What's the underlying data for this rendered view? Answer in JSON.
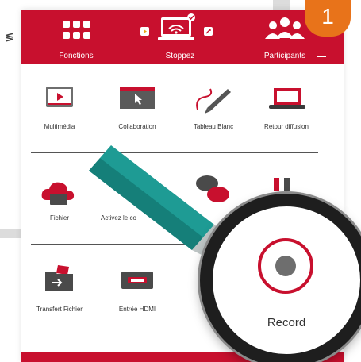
{
  "step_number": "1",
  "toolbar": {
    "fonctions_label": "Fonctions",
    "stop_label": "Stoppez",
    "participants_label": "Participants"
  },
  "row1": [
    {
      "label": "Multimédia",
      "icon": "multimedia-icon"
    },
    {
      "label": "Collaboration",
      "icon": "collaboration-icon"
    },
    {
      "label": "Tableau Blanc",
      "icon": "whiteboard-icon"
    },
    {
      "label": "Retour diffusion",
      "icon": "laptop-icon"
    }
  ],
  "row2": [
    {
      "label": "Fichier",
      "icon": "cloud-file-icon"
    },
    {
      "label": "Activez le co",
      "icon": "marker-icon"
    }
  ],
  "row3": [
    {
      "label": "Transfert Fichier",
      "icon": "folder-transfer-icon"
    },
    {
      "label": "Entrée HDMI",
      "icon": "hdmi-icon"
    }
  ],
  "record": {
    "label": "Record"
  },
  "colors": {
    "brand_red": "#c8102e",
    "badge_orange": "#e8731a"
  }
}
